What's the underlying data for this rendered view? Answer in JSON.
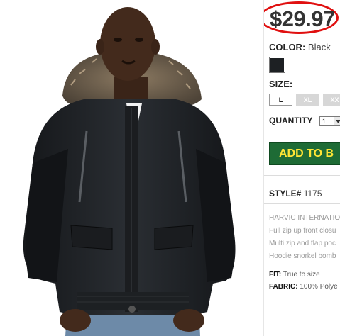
{
  "product": {
    "price": "$29.97",
    "color_label": "COLOR:",
    "color_value": "Black",
    "swatch_color": "#1d2023",
    "size_label": "SIZE:",
    "sizes": [
      {
        "label": "L",
        "available": true,
        "selected": true
      },
      {
        "label": "XL",
        "available": false,
        "selected": false
      },
      {
        "label": "XX",
        "available": false,
        "selected": false
      }
    ],
    "quantity_label": "QUANTITY",
    "quantity_value": "1",
    "add_button": "ADD TO B",
    "add_button_color": "#1e6b35",
    "add_button_text_color": "#ffe535",
    "style_label": "STYLE#",
    "style_number": "1175",
    "description": [
      "HARVIC INTERNATION",
      "Full zip up front closu",
      "Multi zip and flap poc",
      "Hoodie snorkel bomb"
    ],
    "specs": [
      {
        "label": "FIT:",
        "value": "True to size"
      },
      {
        "label": "FABRIC:",
        "value": "100% Polye"
      }
    ]
  },
  "image": {
    "subject": "model wearing black hooded bomber jacket with fur-trimmed hood",
    "jacket_color": "#1e2124"
  },
  "accent_colors": {
    "price_circle": "#e01010"
  }
}
